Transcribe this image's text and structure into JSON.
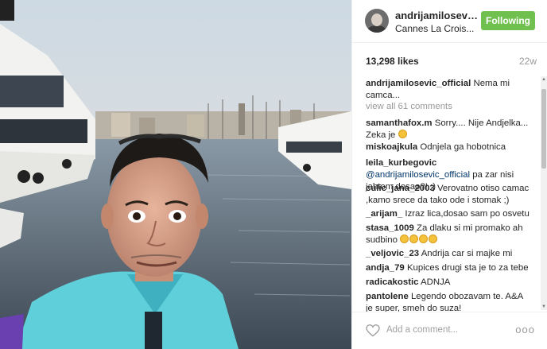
{
  "post": {
    "username": "andrijamilosevic...",
    "location": "Cannes La Crois...",
    "follow_label": "Following",
    "likes": "13,298 likes",
    "time": "22w"
  },
  "caption": {
    "user": "andrijamilosevic_official",
    "text": "Nema mi camca..."
  },
  "view_all": "view all 61 comments",
  "comments": [
    {
      "user": "samanthafox.m",
      "text": "Sorry.... Nije Andjelka... Zeka je",
      "emoji": "heart-eyes"
    },
    {
      "user": "miskoajkula",
      "text": "Odnjela ga hobotnica"
    },
    {
      "user": "leila_kurbegovic",
      "mention": "@andrijamilosevic_official",
      "text": "pa zar nisi jahtom dosao?! :)"
    },
    {
      "user": "culic_jana_2003",
      "text": "Verovatno otiso camac ,kamo srece da tako ode i stomak ;)"
    },
    {
      "user": "_arijam_",
      "text": "Izraz lica,dosao sam po osvetu"
    },
    {
      "user": "stasa_1009",
      "text": "Za dlaku si mi promako ah sudbino",
      "emoji": "grin x4"
    },
    {
      "user": "_veljovic_23",
      "text": "Andrija car si majke mi"
    },
    {
      "user": "andja_79",
      "text": "Kupices drugi sta je to za tebe"
    },
    {
      "user": "radicakostic",
      "text": "ADNJA"
    },
    {
      "user": "pantolene",
      "text": "Legendo obozavam te. A&A je super, smeh do suza!"
    }
  ],
  "add_comment_placeholder": "Add a comment...",
  "more_label": "ooo",
  "colors": {
    "follow_bg": "#70c050",
    "mention": "#003569",
    "muted": "#999999"
  },
  "icons": {
    "like": "heart-outline-icon",
    "more": "ellipsis-icon"
  }
}
